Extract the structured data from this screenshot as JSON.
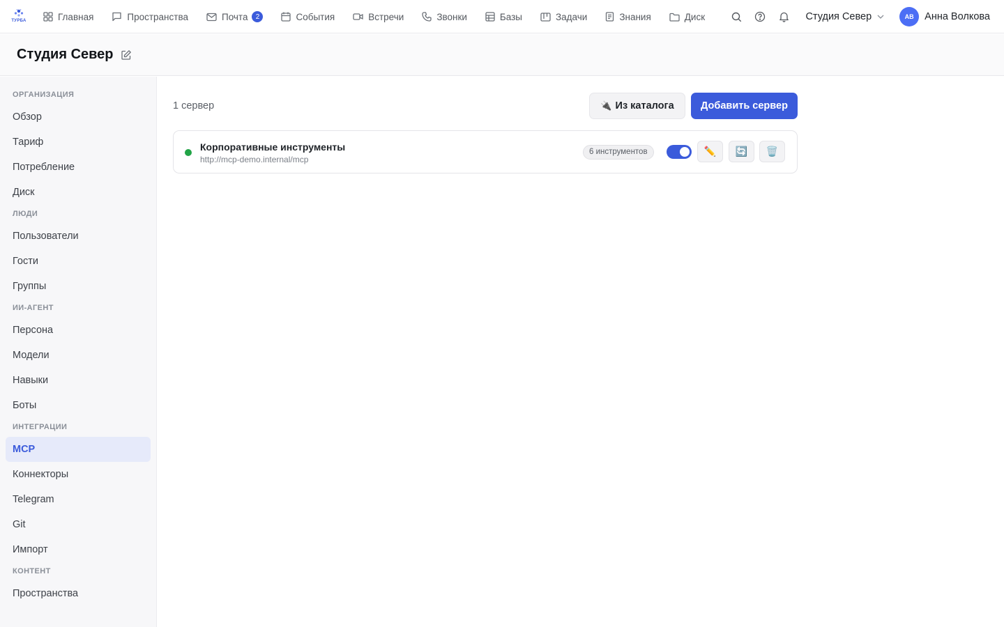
{
  "logo": {
    "text": "ТУРБА"
  },
  "nav": {
    "items": [
      {
        "label": "Главная",
        "icon": "grid-icon"
      },
      {
        "label": "Пространства",
        "icon": "chat-bubble-icon"
      },
      {
        "label": "Почта",
        "icon": "mail-icon",
        "badge": "2"
      },
      {
        "label": "События",
        "icon": "calendar-icon"
      },
      {
        "label": "Встречи",
        "icon": "video-icon"
      },
      {
        "label": "Звонки",
        "icon": "phone-icon"
      },
      {
        "label": "Базы",
        "icon": "table-icon"
      },
      {
        "label": "Задачи",
        "icon": "kanban-icon"
      },
      {
        "label": "Знания",
        "icon": "document-icon"
      },
      {
        "label": "Диск",
        "icon": "folder-icon"
      }
    ]
  },
  "top_right": {
    "org": "Студия Север",
    "avatar_initials": "АВ",
    "user_name": "Анна Волкова"
  },
  "page": {
    "title": "Студия Север"
  },
  "sidebar": {
    "sections": [
      {
        "title": "ОРГАНИЗАЦИЯ",
        "items": [
          "Обзор",
          "Тариф",
          "Потребление",
          "Диск"
        ]
      },
      {
        "title": "ЛЮДИ",
        "items": [
          "Пользователи",
          "Гости",
          "Группы"
        ]
      },
      {
        "title": "ИИ-АГЕНТ",
        "items": [
          "Персона",
          "Модели",
          "Навыки",
          "Боты"
        ]
      },
      {
        "title": "ИНТЕГРАЦИИ",
        "items": [
          "MCP",
          "Коннекторы",
          "Telegram",
          "Git",
          "Импорт"
        ]
      },
      {
        "title": "КОНТЕНТ",
        "items": [
          "Пространства"
        ]
      }
    ],
    "active": "MCP"
  },
  "main": {
    "count": "1 сервер",
    "catalog_button": "Из каталога",
    "add_button": "Добавить сервер",
    "servers": [
      {
        "name": "Корпоративные инструменты",
        "url": "http://mcp-demo.internal/mcp",
        "tools": "6 инструментов",
        "enabled": true,
        "status_color": "#22a447"
      }
    ]
  },
  "colors": {
    "accent": "#3b5bdb",
    "active_bg": "#e6eafa"
  }
}
